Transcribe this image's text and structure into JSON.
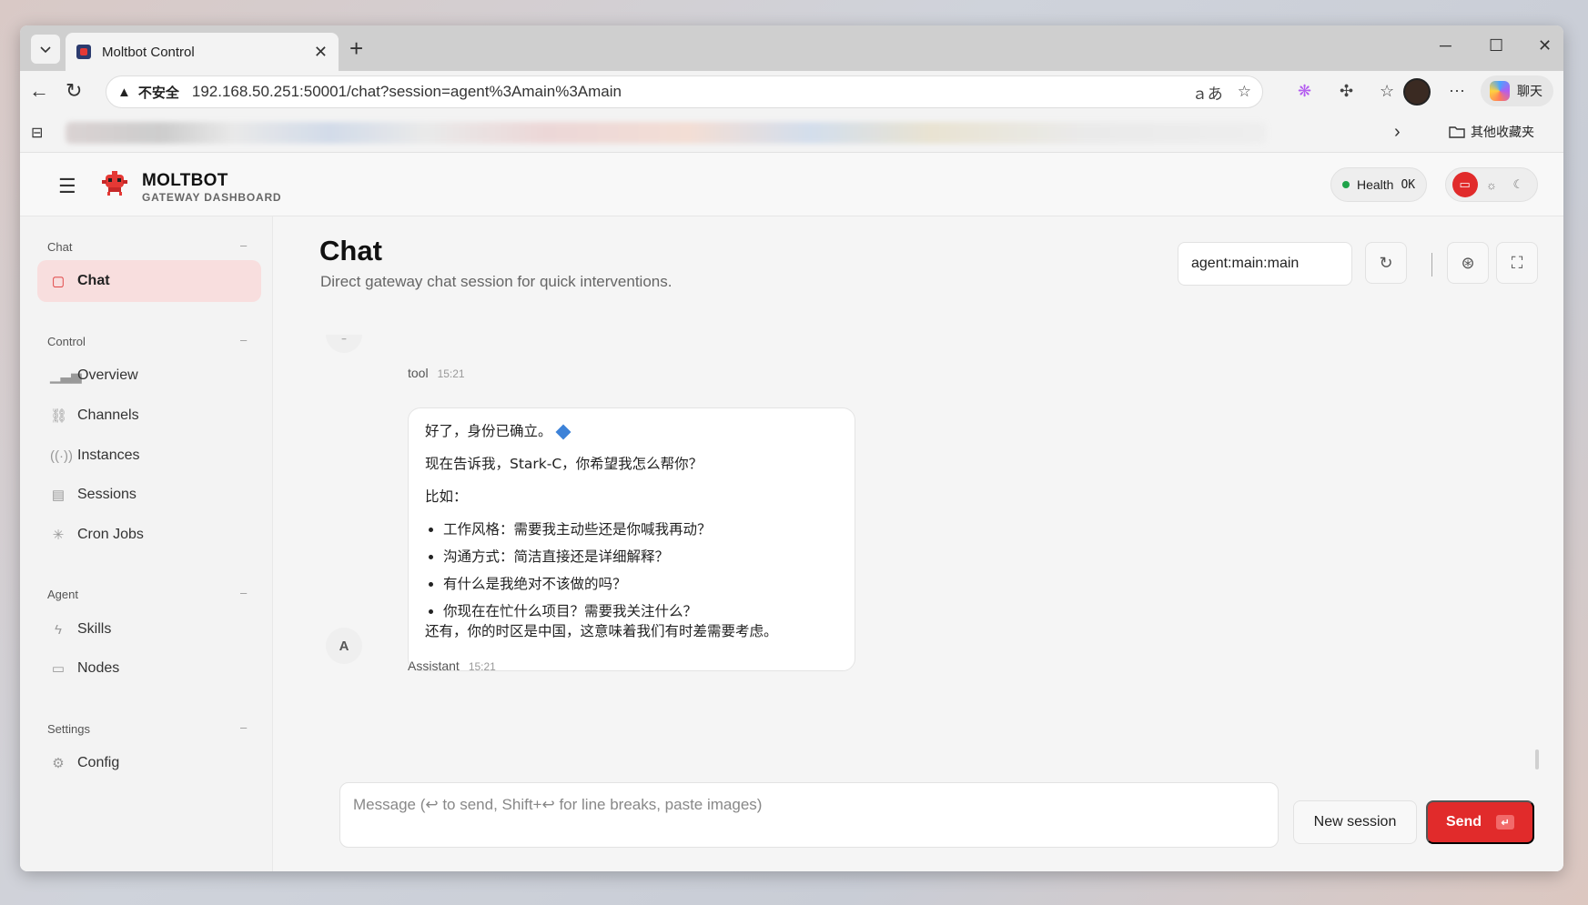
{
  "browser": {
    "tab_title": "Moltbot Control",
    "tab_close": "✕",
    "new_tab": "+",
    "address_insecure": "不安全",
    "address_url": "192.168.50.251:50001/chat?session=agent%3Amain%3Amain",
    "copilot_label": "聊天",
    "other_bookmarks": "其他收藏夹"
  },
  "header": {
    "brand_name": "MOLTBOT",
    "brand_sub": "GATEWAY DASHBOARD",
    "health_label": "Health",
    "health_value": "OK"
  },
  "sidebar": {
    "groups": [
      {
        "label": "Chat",
        "collapse": "–",
        "items": [
          {
            "label": "Chat",
            "icon": "message-icon",
            "active": true
          }
        ]
      },
      {
        "label": "Control",
        "collapse": "–",
        "items": [
          {
            "label": "Overview",
            "icon": "bar-chart-icon"
          },
          {
            "label": "Channels",
            "icon": "link-icon"
          },
          {
            "label": "Instances",
            "icon": "broadcast-icon"
          },
          {
            "label": "Sessions",
            "icon": "document-icon"
          },
          {
            "label": "Cron Jobs",
            "icon": "loader-icon"
          }
        ]
      },
      {
        "label": "Agent",
        "collapse": "–",
        "items": [
          {
            "label": "Skills",
            "icon": "bolt-icon"
          },
          {
            "label": "Nodes",
            "icon": "monitor-icon"
          }
        ]
      },
      {
        "label": "Settings",
        "collapse": "–",
        "items": [
          {
            "label": "Config",
            "icon": "gear-icon"
          }
        ]
      }
    ]
  },
  "main": {
    "title": "Chat",
    "subtitle": "Direct gateway chat session for quick interventions.",
    "session_key": "agent:main:main",
    "messages": [
      {
        "role": "tool",
        "time": "15:21"
      },
      {
        "role": "Assistant",
        "avatar": "A",
        "time": "15:21",
        "lines": {
          "p1": "好了，身份已确立。",
          "p2": "现在告诉我，Stark-C，你希望我怎么帮你？",
          "p3": "比如：",
          "bullets": [
            "工作风格：需要我主动些还是你喊我再动？",
            "沟通方式：简洁直接还是详细解释？",
            "有什么是我绝对不该做的吗？",
            "你现在在忙什么项目？需要我关注什么？"
          ],
          "p4": "还有，你的时区是中国，这意味着我们有时差需要考虑。"
        }
      }
    ],
    "composer_placeholder": "Message (↩ to send, Shift+↩ for line breaks, paste images)",
    "new_session_label": "New session",
    "send_label": "Send",
    "send_kbd": "↵"
  },
  "colors": {
    "accent": "#e12b2b",
    "active_nav_bg": "#f8dede",
    "health_dot": "#1fa34a"
  }
}
